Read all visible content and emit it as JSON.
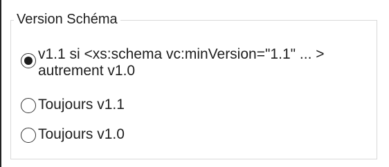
{
  "group": {
    "title": "Version Schéma"
  },
  "options": [
    {
      "label": "v1.1 si <xs:schema vc:minVersion=\"1.1\" ... >\nautrement v1.0",
      "selected": true
    },
    {
      "label": "Toujours v1.1",
      "selected": false
    },
    {
      "label": "Toujours v1.0",
      "selected": false
    }
  ]
}
